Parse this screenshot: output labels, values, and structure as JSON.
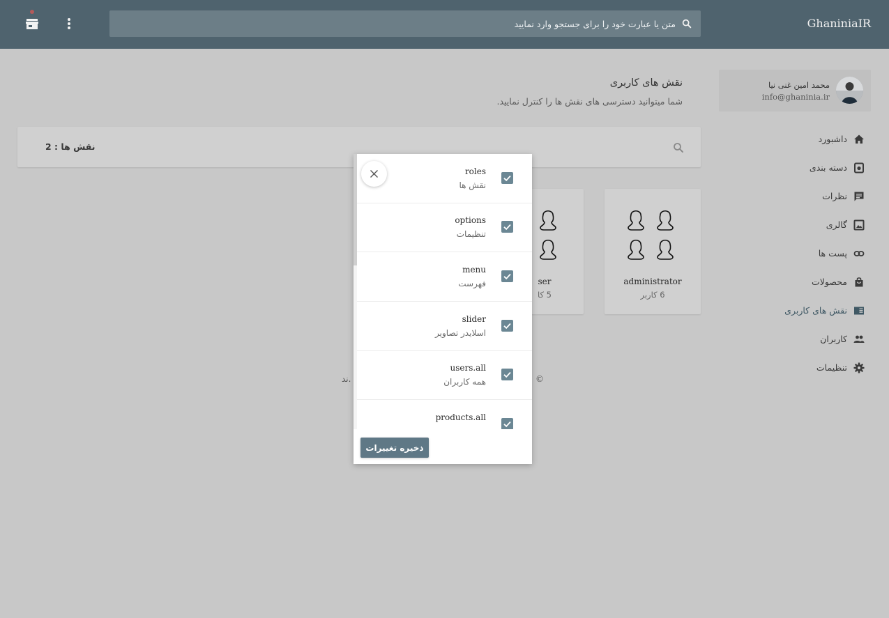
{
  "header": {
    "brand": "GhaniniaIR",
    "search_placeholder": "متن یا عبارت خود را برای جستجو وارد نمایید",
    "icons": [
      "search-icon",
      "more-vert-icon",
      "store-icon"
    ]
  },
  "sidebar": {
    "profile": {
      "name": "محمد امین غنی نیا",
      "email": "info@ghaninia.ir"
    },
    "items": [
      {
        "label": "داشبورد",
        "icon": "home-icon"
      },
      {
        "label": "دسته بندی",
        "icon": "category-icon"
      },
      {
        "label": "نظرات",
        "icon": "comment-icon"
      },
      {
        "label": "گالری",
        "icon": "image-icon"
      },
      {
        "label": "پست ها",
        "icon": "link-icon"
      },
      {
        "label": "محصولات",
        "icon": "shopping-bag-icon"
      },
      {
        "label": "نقش های کاربری",
        "icon": "chrome-reader-icon",
        "active": true
      },
      {
        "label": "کاربران",
        "icon": "people-icon"
      },
      {
        "label": "تنظیمات",
        "icon": "settings-icon"
      }
    ]
  },
  "page": {
    "title": "نقش های کاربری",
    "subtitle": "شما میتوانید دسترسی های نقش ها را کنترل نمایید.",
    "roles_count": "نقش ها : 2"
  },
  "roles": [
    {
      "name": "administrator",
      "count": "6 کاربر"
    },
    {
      "name": "ser",
      "count": "5 کا"
    }
  ],
  "footer": {
    "right_fragment": "©",
    "left_fragment": "ند."
  },
  "modal": {
    "permissions": [
      {
        "key": "roles",
        "label": "نقش ها",
        "checked": true
      },
      {
        "key": "options",
        "label": "تنظیمات",
        "checked": true
      },
      {
        "key": "menu",
        "label": "فهرست",
        "checked": true
      },
      {
        "key": "slider",
        "label": "اسلایدر تصاویر",
        "checked": true
      },
      {
        "key": "users.all",
        "label": "همه کاربران",
        "checked": true
      },
      {
        "key": "products.all",
        "label": "",
        "checked": true
      }
    ],
    "save_label": "ذخیره تغییرات"
  },
  "colors": {
    "header_bg": "#4f636e",
    "accent": "#5f7886",
    "checkbox": "#6b8794",
    "page_bg": "#c8c8c8"
  }
}
